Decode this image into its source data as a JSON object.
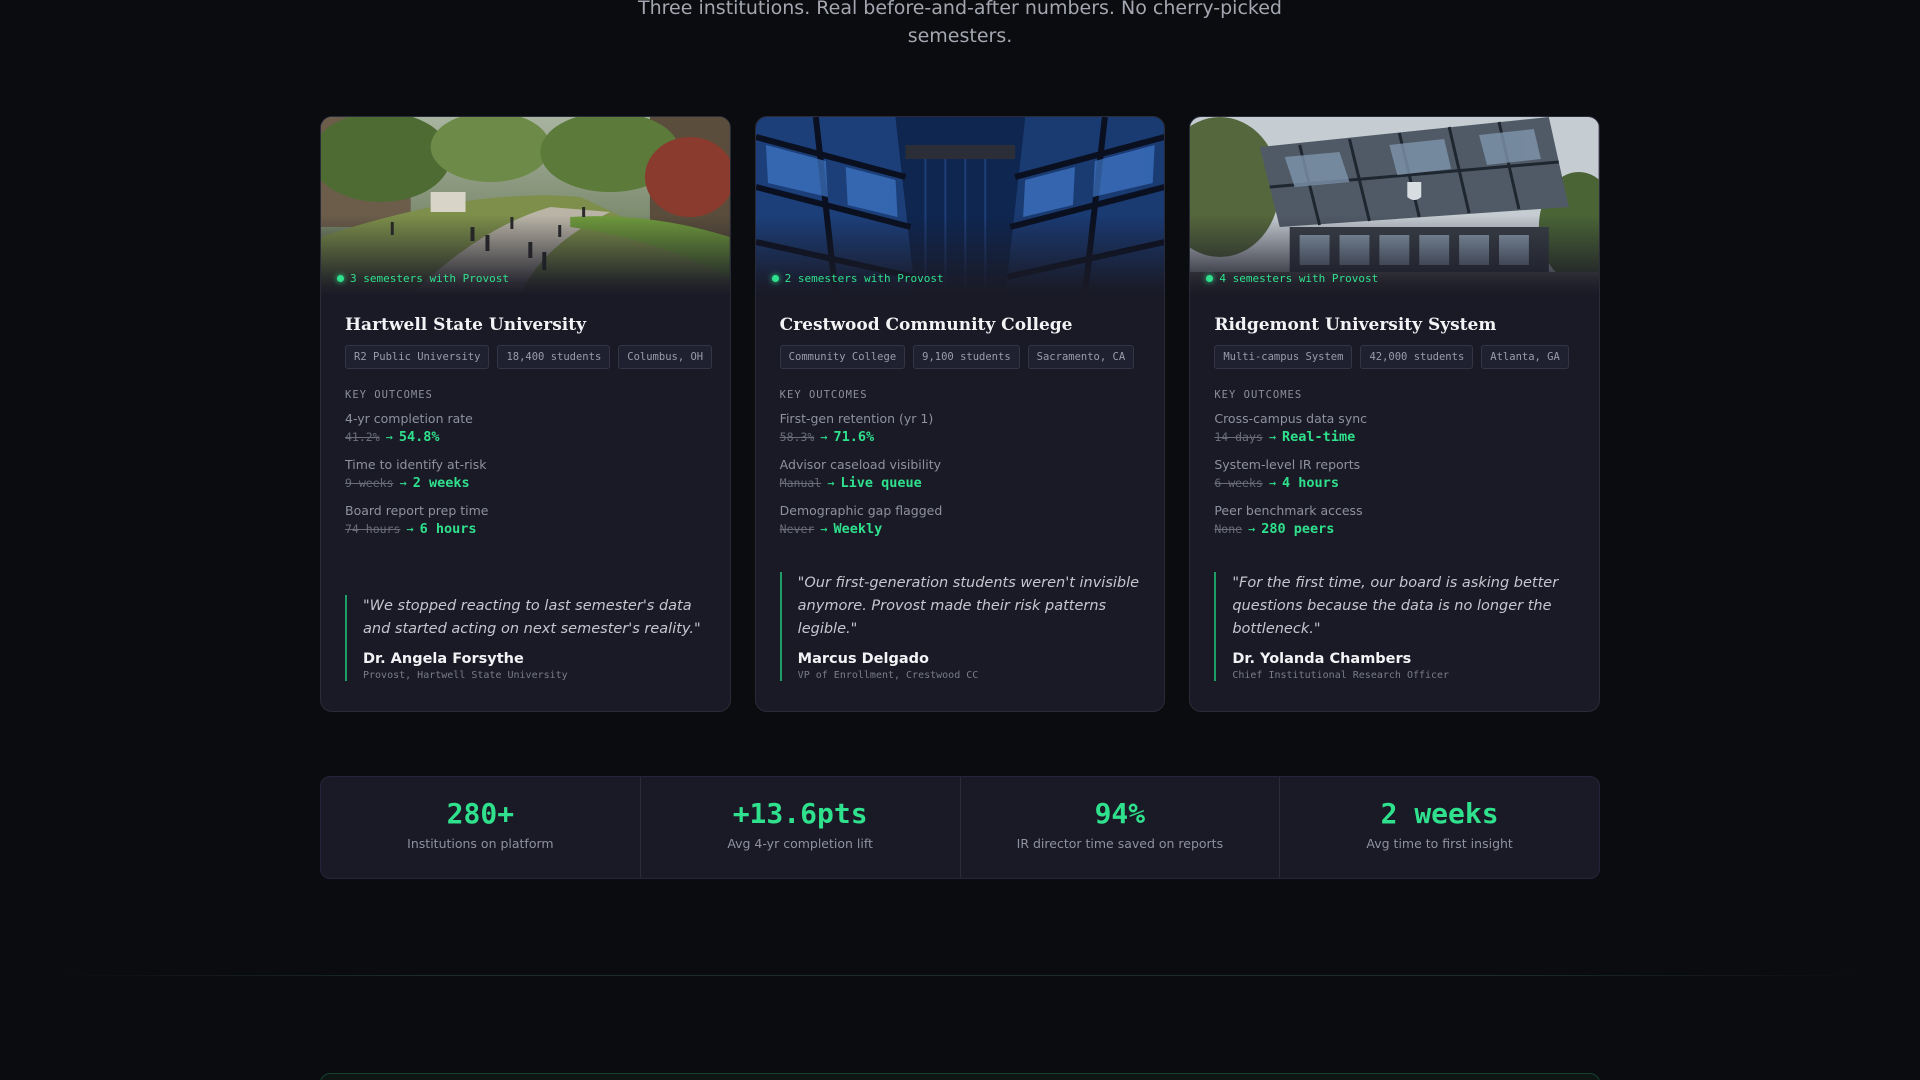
{
  "header": {
    "subtitle": "Three institutions. Real before-and-after numbers. No cherry-picked semesters."
  },
  "section_labels": {
    "key_outcomes": "KEY OUTCOMES"
  },
  "cards": [
    {
      "tenure": "3 semesters with Provost",
      "name": "Hartwell State University",
      "tags": [
        "R2 Public University",
        "18,400 students",
        "Columbus, OH"
      ],
      "outcomes": [
        {
          "label": "4-yr completion rate",
          "before": "41.2%",
          "after": "54.8%"
        },
        {
          "label": "Time to identify at-risk",
          "before": "9 weeks",
          "after": "2 weeks"
        },
        {
          "label": "Board report prep time",
          "before": "74 hours",
          "after": "6 hours"
        }
      ],
      "quote": "\"We stopped reacting to last semester's data and started acting on next semester's reality.\"",
      "person": "Dr. Angela Forsythe",
      "role": "Provost, Hartwell State University"
    },
    {
      "tenure": "2 semesters with Provost",
      "name": "Crestwood Community College",
      "tags": [
        "Community College",
        "9,100 students",
        "Sacramento, CA"
      ],
      "outcomes": [
        {
          "label": "First-gen retention (yr 1)",
          "before": "58.3%",
          "after": "71.6%"
        },
        {
          "label": "Advisor caseload visibility",
          "before": "Manual",
          "after": "Live queue"
        },
        {
          "label": "Demographic gap flagged",
          "before": "Never",
          "after": "Weekly"
        }
      ],
      "quote": "\"Our first-generation students weren't invisible anymore. Provost made their risk patterns legible.\"",
      "person": "Marcus Delgado",
      "role": "VP of Enrollment, Crestwood CC"
    },
    {
      "tenure": "4 semesters with Provost",
      "name": "Ridgemont University System",
      "tags": [
        "Multi-campus System",
        "42,000 students",
        "Atlanta, GA"
      ],
      "outcomes": [
        {
          "label": "Cross-campus data sync",
          "before": "14 days",
          "after": "Real-time"
        },
        {
          "label": "System-level IR reports",
          "before": "6 weeks",
          "after": "4 hours"
        },
        {
          "label": "Peer benchmark access",
          "before": "None",
          "after": "280 peers"
        }
      ],
      "quote": "\"For the first time, our board is asking better questions because the data is no longer the bottleneck.\"",
      "person": "Dr. Yolanda Chambers",
      "role": "Chief Institutional Research Officer"
    }
  ],
  "stats": [
    {
      "value": "280+",
      "label": "Institutions on platform"
    },
    {
      "value": "+13.6pts",
      "label": "Avg 4-yr completion lift"
    },
    {
      "value": "94%",
      "label": "IR director time saved on reports"
    },
    {
      "value": "2 weeks",
      "label": "Avg time to first insight"
    }
  ],
  "colors": {
    "accent": "#2fe08c",
    "card_bg": "#1a1a26",
    "page_bg": "#0b0c10"
  },
  "icons": {
    "arrow": "→",
    "status_dot": "status-dot-icon"
  }
}
